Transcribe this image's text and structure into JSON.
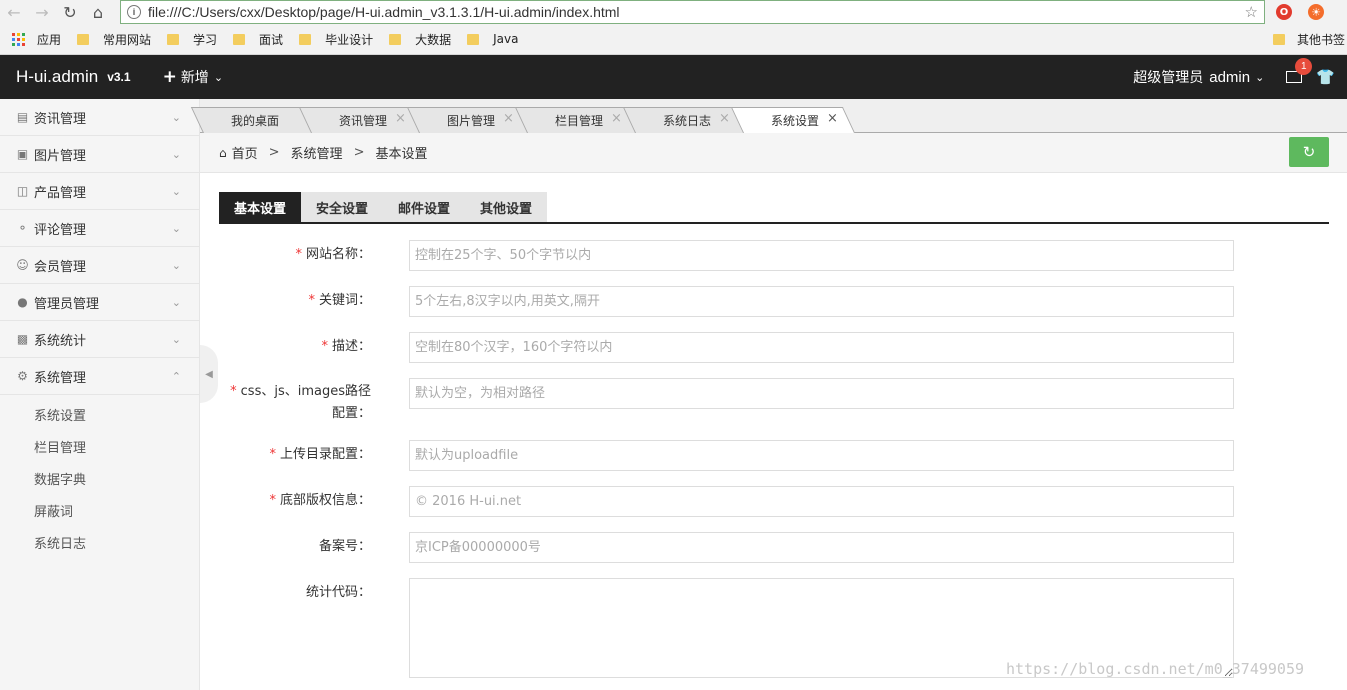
{
  "browser": {
    "url": "file:///C:/Users/cxx/Desktop/page/H-ui.admin_v3.1.3.1/H-ui.admin/index.html",
    "bookmarks": [
      "应用",
      "常用网站",
      "学习",
      "面试",
      "毕业设计",
      "大数据",
      "Java"
    ],
    "other_bookmarks": "其他书签",
    "ext_badge": "1"
  },
  "header": {
    "logo": "H-ui.admin",
    "version": "v3.1",
    "new_label": "新增",
    "role": "超级管理员",
    "user": "admin",
    "mail_count": "1"
  },
  "sidebar": {
    "items": [
      {
        "label": "资讯管理",
        "icon": "news-icon"
      },
      {
        "label": "图片管理",
        "icon": "image-icon"
      },
      {
        "label": "产品管理",
        "icon": "bag-icon"
      },
      {
        "label": "评论管理",
        "icon": "comment-icon"
      },
      {
        "label": "会员管理",
        "icon": "user-icon"
      },
      {
        "label": "管理员管理",
        "icon": "admin-icon"
      },
      {
        "label": "系统统计",
        "icon": "stats-icon"
      },
      {
        "label": "系统管理",
        "icon": "gear-icon"
      }
    ],
    "subitems": [
      "系统设置",
      "栏目管理",
      "数据字典",
      "屏蔽词",
      "系统日志"
    ]
  },
  "tabs": [
    {
      "label": "我的桌面"
    },
    {
      "label": "资讯管理"
    },
    {
      "label": "图片管理"
    },
    {
      "label": "栏目管理"
    },
    {
      "label": "系统日志"
    },
    {
      "label": "系统设置"
    }
  ],
  "breadcrumb": {
    "home": "首页",
    "sep": ">",
    "level1": "系统管理",
    "level2": "基本设置"
  },
  "settings_tabs": [
    "基本设置",
    "安全设置",
    "邮件设置",
    "其他设置"
  ],
  "form": {
    "required_mark": "*",
    "fields": [
      {
        "label": "网站名称：",
        "placeholder": "控制在25个字、50个字节以内",
        "value": ""
      },
      {
        "label": "关键词：",
        "placeholder": "5个左右,8汉字以内,用英文,隔开",
        "value": ""
      },
      {
        "label": "描述：",
        "placeholder": "空制在80个汉字，160个字符以内",
        "value": ""
      },
      {
        "label": "css、js、images路径配置：",
        "placeholder": "默认为空，为相对路径",
        "value": ""
      },
      {
        "label": "上传目录配置：",
        "placeholder": "默认为uploadfile",
        "value": ""
      },
      {
        "label": "底部版权信息：",
        "placeholder": "© 2016 H-ui.net",
        "value": ""
      },
      {
        "label": "备案号：",
        "placeholder": "京ICP备00000000号",
        "value": ""
      },
      {
        "label": "统计代码：",
        "value": ""
      }
    ]
  },
  "watermark": "https://blog.csdn.net/m0_37499059"
}
